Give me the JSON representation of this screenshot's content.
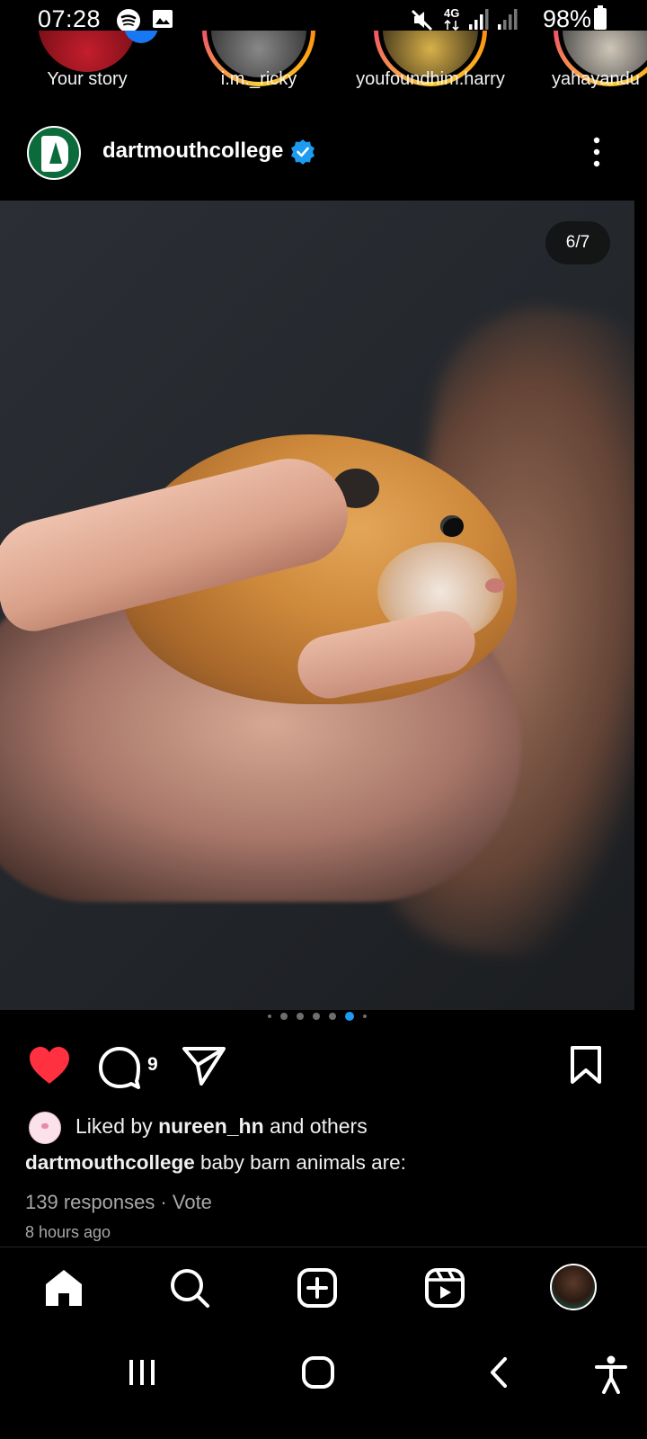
{
  "status_bar": {
    "time": "07:28",
    "battery": "98%",
    "network": "4G"
  },
  "stories": [
    {
      "label": "Your story",
      "own": true
    },
    {
      "label": "i.m._ricky",
      "own": false
    },
    {
      "label": "youfoundhim.harry",
      "own": false
    },
    {
      "label": "yahayandu",
      "own": false
    }
  ],
  "post": {
    "account": "dartmouthcollege",
    "slide_counter": "6/7",
    "comment_count": "9",
    "liked_by_prefix": "Liked by ",
    "liked_by_user": "nureen_hn",
    "liked_by_suffix": " and others",
    "caption_user": "dartmouthcollege",
    "caption_text": " baby barn animals are:",
    "poll_meta": "139 responses · Vote",
    "time_ago": "8 hours ago",
    "liked": true
  },
  "colors": {
    "accent": "#1d9bf0",
    "like": "#ff3040",
    "background": "#000000"
  },
  "icons": {
    "like": "heart-icon",
    "comment": "comment-icon",
    "share": "send-icon",
    "save": "bookmark-icon",
    "home": "home-icon",
    "search": "search-icon",
    "create": "create-icon",
    "reels": "reels-icon"
  }
}
